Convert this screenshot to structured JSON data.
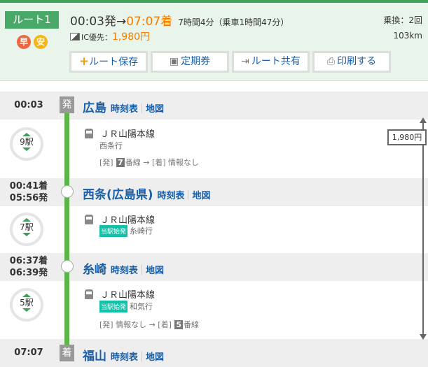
{
  "route": {
    "label": "ルート1",
    "tags": [
      "早",
      "安"
    ],
    "dep": "00:03発",
    "arrow": "→",
    "arr": "07:07着",
    "duration": "7時間4分（乗車1時間47分）",
    "ic_label": "IC優先：",
    "fare": "1,980円",
    "transfers": "乗換：2回",
    "distance": "103km"
  },
  "buttons": {
    "save": "ルート保存",
    "teiki": "定期券",
    "share": "ルート共有",
    "print": "印刷する"
  },
  "stations": [
    {
      "time": "00:03",
      "mark": "発",
      "name": "広島",
      "timetable": "時刻表",
      "map": "地図"
    },
    {
      "time1": "00:41着",
      "time2": "05:56発",
      "name": "西条(広島県)",
      "timetable": "時刻表",
      "map": "地図"
    },
    {
      "time1": "06:37着",
      "time2": "06:39発",
      "name": "糸崎",
      "timetable": "時刻表",
      "map": "地図"
    },
    {
      "time": "07:07",
      "mark": "着",
      "name": "福山",
      "timetable": "時刻表",
      "map": "地図"
    }
  ],
  "segments": [
    {
      "stops": "9駅",
      "line": "ＪＲ山陽本線",
      "dest": "西条行",
      "plat_dep": "[発]",
      "plat_dep_num": "7",
      "plat_dep_text": "番線 → [着] 情報なし"
    },
    {
      "stops": "7駅",
      "line": "ＪＲ山陽本線",
      "tag": "当駅始発",
      "dest": "糸崎行"
    },
    {
      "stops": "5駅",
      "line": "ＪＲ山陽本線",
      "tag": "当駅始発",
      "dest": "和気行",
      "plat_text": "[発] 情報なし → [着]",
      "plat_arr_num": "5",
      "plat_arr_text": "番線"
    }
  ],
  "fare_total": "1,980円"
}
